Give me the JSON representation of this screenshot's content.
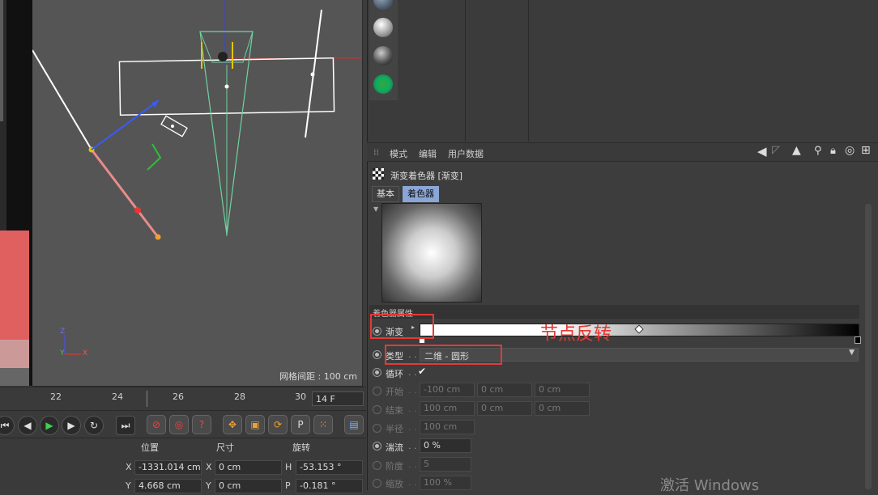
{
  "viewport": {
    "grid_label": "网格间距 : 100 cm",
    "axis_x": "X",
    "axis_y": "Y",
    "axis_z": "Z"
  },
  "timeline": {
    "ticks": [
      "22",
      "24",
      "26",
      "28",
      "30"
    ],
    "frame_value": "14 F"
  },
  "coords": {
    "header_position": "位置",
    "header_size": "尺寸",
    "header_rotation": "旋转",
    "rows": [
      {
        "axis1": "X",
        "pos": "-1331.014 cm",
        "axis2": "X",
        "size": "0 cm",
        "axis3": "H",
        "rot": "-53.153 °"
      },
      {
        "axis1": "Y",
        "pos": "4.668 cm",
        "axis2": "Y",
        "size": "0 cm",
        "axis3": "P",
        "rot": "-0.181 °"
      }
    ]
  },
  "attribute_manager": {
    "menu": [
      "模式",
      "编辑",
      "用户数据"
    ],
    "title": "渐变着色器 [渐变]",
    "tabs": [
      "基本",
      "着色器"
    ],
    "active_tab": "着色器",
    "section_header": "着色器属性",
    "gradient_label": "渐变",
    "annotation": "节点反转",
    "type_label": "类型",
    "type_value": "二维 - 圆形",
    "cycle_label": "循环",
    "cycle_check": "✔",
    "start_label": "开始",
    "start_values": [
      "-100 cm",
      "0 cm",
      "0 cm"
    ],
    "end_label": "结束",
    "end_values": [
      "100 cm",
      "0 cm",
      "0 cm"
    ],
    "radius_label": "半径",
    "radius_value": "100 cm",
    "turbulence_label": "湍流",
    "turbulence_value": "0 %",
    "octaves_label": "阶度",
    "octaves_value": "5",
    "scale_label": "缩放",
    "scale_value": "100 %",
    "dots": ". ."
  },
  "watermark": "激活 Windows",
  "colors": {
    "accent_red": "#e53935",
    "active_tab": "#8aa6d6"
  }
}
